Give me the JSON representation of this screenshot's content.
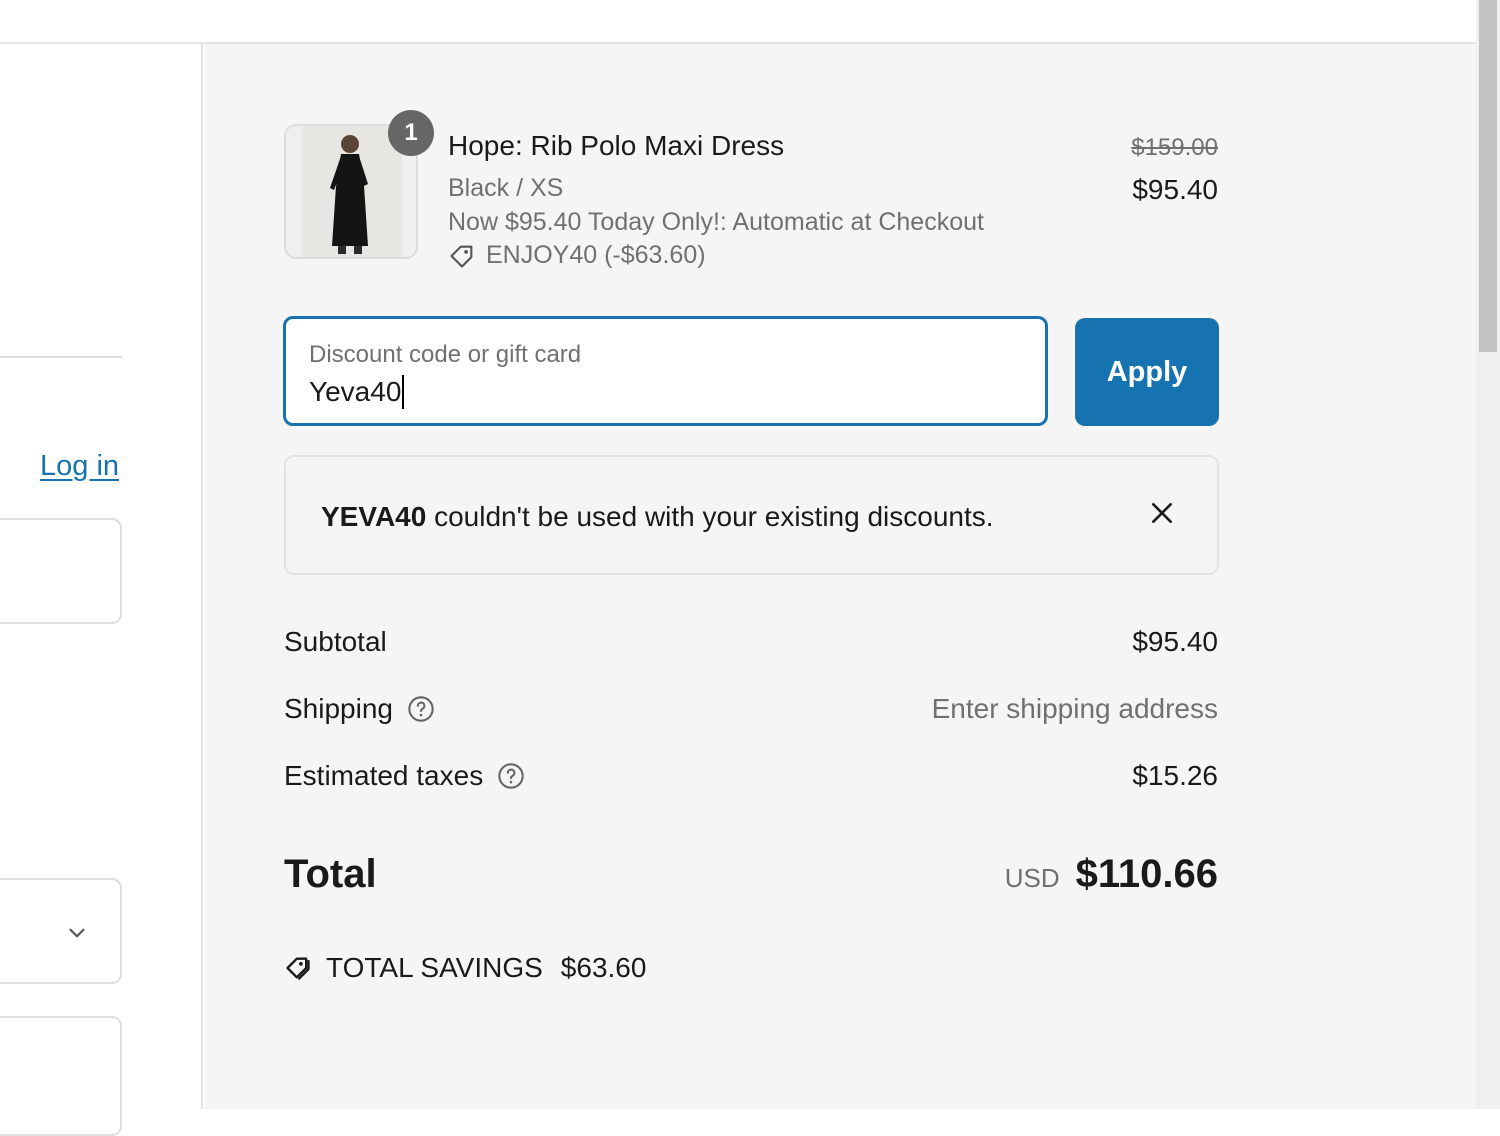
{
  "left": {
    "login_label": "Log in"
  },
  "product": {
    "quantity": "1",
    "title": "Hope: Rib Polo Maxi Dress",
    "variant": "Black / XS",
    "promo": "Now $95.40 Today Only!: Automatic at Checkout",
    "discount_line": "ENJOY40 (-$63.60)",
    "price_original": "$159.00",
    "price_final": "$95.40",
    "image_icon": "dress-photo"
  },
  "discount": {
    "label": "Discount code or gift card",
    "value": "Yeva40",
    "apply_label": "Apply"
  },
  "error": {
    "code": "YEVA40",
    "message": " couldn't be used with your existing discounts."
  },
  "summary": {
    "subtotal_label": "Subtotal",
    "subtotal_value": "$95.40",
    "shipping_label": "Shipping",
    "shipping_value": "Enter shipping address",
    "taxes_label": "Estimated taxes",
    "taxes_value": "$15.26",
    "total_label": "Total",
    "currency": "USD",
    "total_value": "$110.66",
    "savings_label": "TOTAL SAVINGS",
    "savings_value": "$63.60"
  },
  "colors": {
    "accent": "#1773b0",
    "panel_bg": "#f5f5f5",
    "muted_text": "#707070"
  }
}
